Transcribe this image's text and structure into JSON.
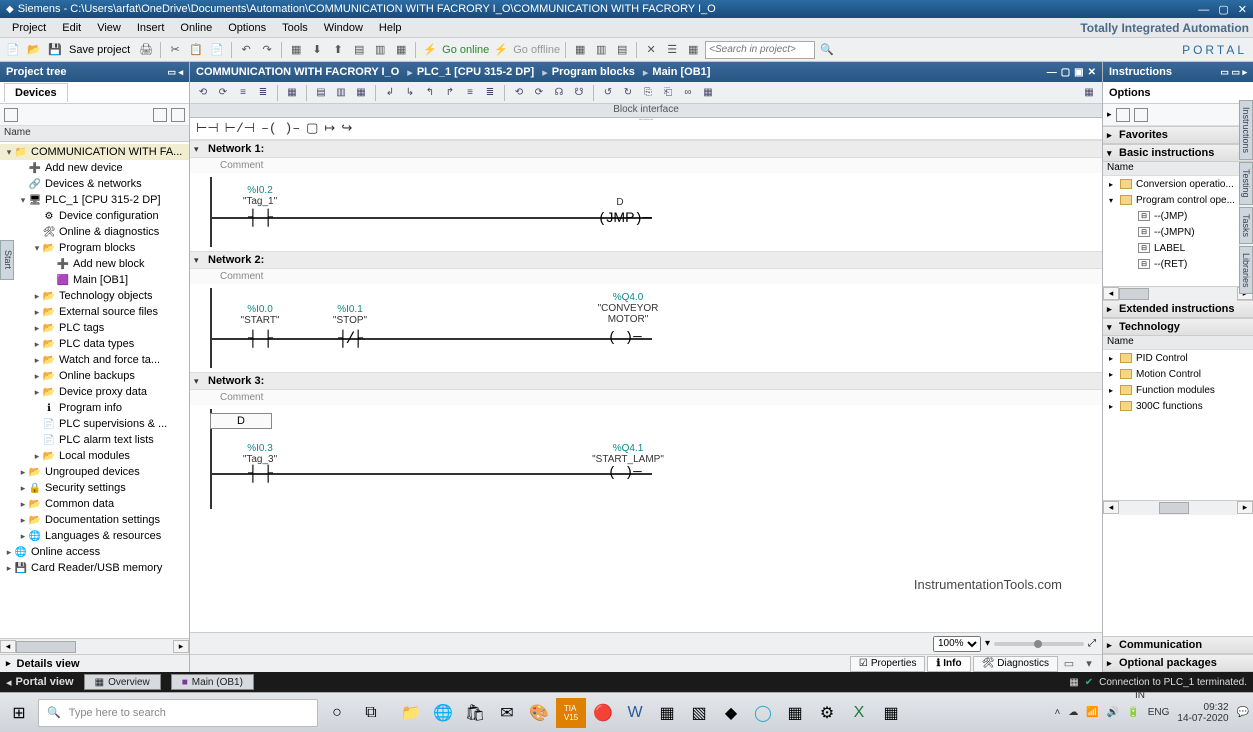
{
  "title_bar": {
    "app": "Siemens",
    "separator": " - ",
    "path": "C:\\Users\\arfat\\OneDrive\\Documents\\Automation\\COMMUNICATION WITH FACRORY I_O\\COMMUNICATION WITH FACRORY I_O"
  },
  "menu": {
    "items": [
      "Project",
      "Edit",
      "View",
      "Insert",
      "Online",
      "Options",
      "Tools",
      "Window",
      "Help"
    ],
    "right_logo": "Totally Integrated Automation"
  },
  "portal_badge": "PORTAL",
  "toolbar": {
    "save_label": "Save project",
    "go_online": "Go online",
    "go_offline": "Go offline",
    "search_placeholder": "<Search in project>"
  },
  "project_tree": {
    "title": "Project tree",
    "devices_tab": "Devices",
    "name_col": "Name",
    "details_view": "Details view",
    "items": [
      {
        "indent": 0,
        "arrow": "▾",
        "icon": "📁",
        "label": "COMMUNICATION WITH FA...",
        "hl": true
      },
      {
        "indent": 1,
        "arrow": "",
        "icon": "➕",
        "label": "Add new device"
      },
      {
        "indent": 1,
        "arrow": "",
        "icon": "🔗",
        "label": "Devices & networks"
      },
      {
        "indent": 1,
        "arrow": "▾",
        "icon": "🖥",
        "label": "PLC_1 [CPU 315-2 DP]"
      },
      {
        "indent": 2,
        "arrow": "",
        "icon": "⚙",
        "label": "Device configuration"
      },
      {
        "indent": 2,
        "arrow": "",
        "icon": "🛠",
        "label": "Online & diagnostics"
      },
      {
        "indent": 2,
        "arrow": "▾",
        "icon": "📂",
        "label": "Program blocks"
      },
      {
        "indent": 3,
        "arrow": "",
        "icon": "➕",
        "label": "Add new block"
      },
      {
        "indent": 3,
        "arrow": "",
        "icon": "🟪",
        "label": "Main [OB1]"
      },
      {
        "indent": 2,
        "arrow": "▸",
        "icon": "📂",
        "label": "Technology objects"
      },
      {
        "indent": 2,
        "arrow": "▸",
        "icon": "📂",
        "label": "External source files"
      },
      {
        "indent": 2,
        "arrow": "▸",
        "icon": "📂",
        "label": "PLC tags"
      },
      {
        "indent": 2,
        "arrow": "▸",
        "icon": "📂",
        "label": "PLC data types"
      },
      {
        "indent": 2,
        "arrow": "▸",
        "icon": "📂",
        "label": "Watch and force ta..."
      },
      {
        "indent": 2,
        "arrow": "▸",
        "icon": "📂",
        "label": "Online backups"
      },
      {
        "indent": 2,
        "arrow": "▸",
        "icon": "📂",
        "label": "Device proxy data"
      },
      {
        "indent": 2,
        "arrow": "",
        "icon": "ℹ",
        "label": "Program info"
      },
      {
        "indent": 2,
        "arrow": "",
        "icon": "📄",
        "label": "PLC supervisions & ..."
      },
      {
        "indent": 2,
        "arrow": "",
        "icon": "📄",
        "label": "PLC alarm text lists"
      },
      {
        "indent": 2,
        "arrow": "▸",
        "icon": "📂",
        "label": "Local modules"
      },
      {
        "indent": 1,
        "arrow": "▸",
        "icon": "📂",
        "label": "Ungrouped devices"
      },
      {
        "indent": 1,
        "arrow": "▸",
        "icon": "🔒",
        "label": "Security settings"
      },
      {
        "indent": 1,
        "arrow": "▸",
        "icon": "📂",
        "label": "Common data"
      },
      {
        "indent": 1,
        "arrow": "▸",
        "icon": "📂",
        "label": "Documentation settings"
      },
      {
        "indent": 1,
        "arrow": "▸",
        "icon": "🌐",
        "label": "Languages & resources"
      },
      {
        "indent": 0,
        "arrow": "▸",
        "icon": "🌐",
        "label": "Online access"
      },
      {
        "indent": 0,
        "arrow": "▸",
        "icon": "💾",
        "label": "Card Reader/USB memory"
      }
    ]
  },
  "side_tab_left": "Start",
  "breadcrumb": {
    "crumbs": [
      "COMMUNICATION WITH FACRORY I_O",
      "PLC_1 [CPU 315-2 DP]",
      "Program blocks",
      "Main [OB1]"
    ]
  },
  "block_interface": "Block interface",
  "networks": [
    {
      "title": "Network 1:",
      "comment": "Comment",
      "type": "jmp",
      "contact": {
        "addr": "%I0.2",
        "tag": "\"Tag_1\""
      },
      "out": {
        "label": "D",
        "op": "JMP"
      }
    },
    {
      "title": "Network 2:",
      "comment": "Comment",
      "type": "motor",
      "c1": {
        "addr": "%I0.0",
        "tag": "\"START\""
      },
      "c2": {
        "addr": "%I0.1",
        "tag": "\"STOP\""
      },
      "out": {
        "addr": "%Q4.0",
        "tag": "\"CONVEYOR MOTOR\""
      }
    },
    {
      "title": "Network 3:",
      "comment": "Comment",
      "type": "lamp",
      "lbl": "D",
      "contact": {
        "addr": "%I0.3",
        "tag": "\"Tag_3\""
      },
      "out": {
        "addr": "%Q4.1",
        "tag": "\"START_LAMP\""
      }
    }
  ],
  "zoom": "100%",
  "prop_tabs": {
    "properties": "Properties",
    "info": "Info",
    "diagnostics": "Diagnostics"
  },
  "instructions": {
    "title": "Instructions",
    "options": "Options",
    "favorites": "Favorites",
    "basic": "Basic instructions",
    "name_col": "Name",
    "basic_items": [
      {
        "arrow": "▸",
        "icon": "folder",
        "label": "Conversion operatio..."
      },
      {
        "arrow": "▾",
        "icon": "folder",
        "label": "Program control ope..."
      },
      {
        "arrow": "",
        "icon": "box",
        "label": "--(JMP)"
      },
      {
        "arrow": "",
        "icon": "box",
        "label": "--(JMPN)"
      },
      {
        "arrow": "",
        "icon": "box",
        "label": "LABEL"
      },
      {
        "arrow": "",
        "icon": "box",
        "label": "--(RET)"
      }
    ],
    "extended": "Extended instructions",
    "technology": "Technology",
    "tech_items": [
      {
        "label": "PID Control"
      },
      {
        "label": "Motion Control"
      },
      {
        "label": "Function modules"
      },
      {
        "label": "300C functions"
      }
    ],
    "communication": "Communication",
    "optional": "Optional packages"
  },
  "side_tabs_right": [
    "Instructions",
    "Testing",
    "Tasks",
    "Libraries"
  ],
  "watermark": "InstrumentationTools.com",
  "portal_bar": {
    "portal_view": "Portal view",
    "overview": "Overview",
    "main_tab": "Main (OB1)",
    "status": "Connection to PLC_1 terminated."
  },
  "taskbar": {
    "search_placeholder": "Type here to search",
    "lang1": "ENG",
    "lang2": "IN",
    "time": "09:32",
    "date": "14-07-2020"
  }
}
